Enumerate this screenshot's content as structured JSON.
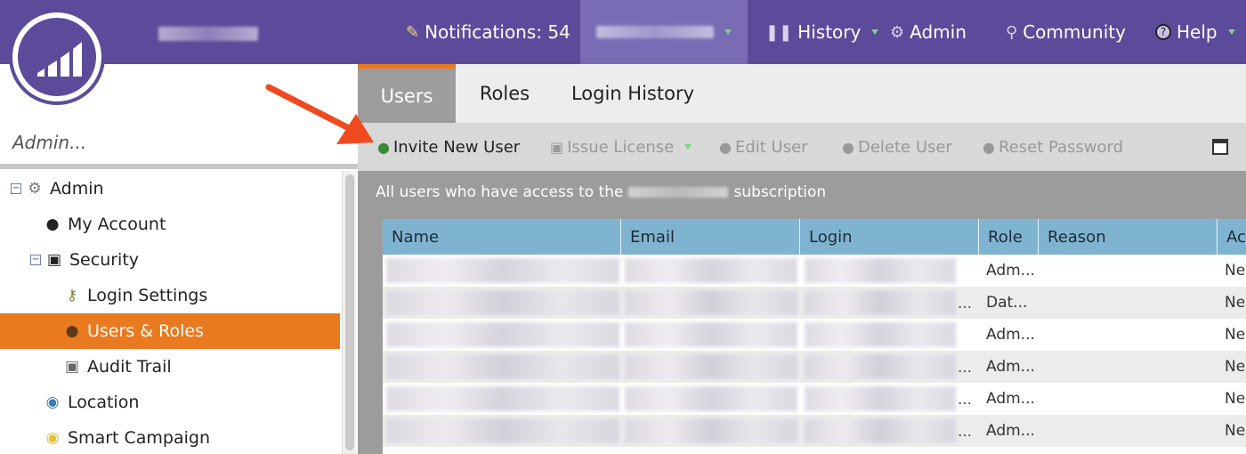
{
  "topbar": {
    "notifications_label": "Notifications: 54",
    "history_label": "History",
    "admin_label": "Admin",
    "community_label": "Community",
    "help_label": "Help"
  },
  "sidebar": {
    "search_placeholder": "Admin...",
    "items": [
      {
        "label": "Admin",
        "icon": "gear-icon"
      },
      {
        "label": "My Account",
        "icon": "person-icon"
      },
      {
        "label": "Security",
        "icon": "lock-icon"
      },
      {
        "label": "Login Settings",
        "icon": "key-icon"
      },
      {
        "label": "Users & Roles",
        "icon": "users-icon",
        "selected": true
      },
      {
        "label": "Audit Trail",
        "icon": "camera-icon"
      },
      {
        "label": "Location",
        "icon": "globe-icon"
      },
      {
        "label": "Smart Campaign",
        "icon": "lightbulb-icon"
      }
    ]
  },
  "tabs": [
    {
      "label": "Users",
      "active": true
    },
    {
      "label": "Roles"
    },
    {
      "label": "Login History"
    }
  ],
  "toolbar": {
    "invite_label": "Invite New User",
    "issue_license_label": "Issue License",
    "edit_user_label": "Edit User",
    "delete_user_label": "Delete User",
    "reset_password_label": "Reset Password"
  },
  "content": {
    "caption_prefix": "All users who have access to the",
    "caption_suffix": "subscription"
  },
  "grid": {
    "columns": [
      "Name",
      "Email",
      "Login",
      "Role",
      "Reason",
      "Ac"
    ],
    "rows": [
      {
        "role": "Adm...",
        "access": "Ne"
      },
      {
        "role": "Dat...",
        "access": "Ne"
      },
      {
        "role": "Adm...",
        "access": "Ne"
      },
      {
        "role": "Adm...",
        "access": "Ne"
      },
      {
        "role": "Adm...",
        "access": "Ne"
      },
      {
        "role": "Adm...",
        "access": "Ne"
      }
    ]
  },
  "colors": {
    "header_purple": "#5c4b9a",
    "accent_orange": "#ea7a1f",
    "grid_header_blue": "#7fb4d0",
    "annotation_arrow": "#f04a1e"
  }
}
